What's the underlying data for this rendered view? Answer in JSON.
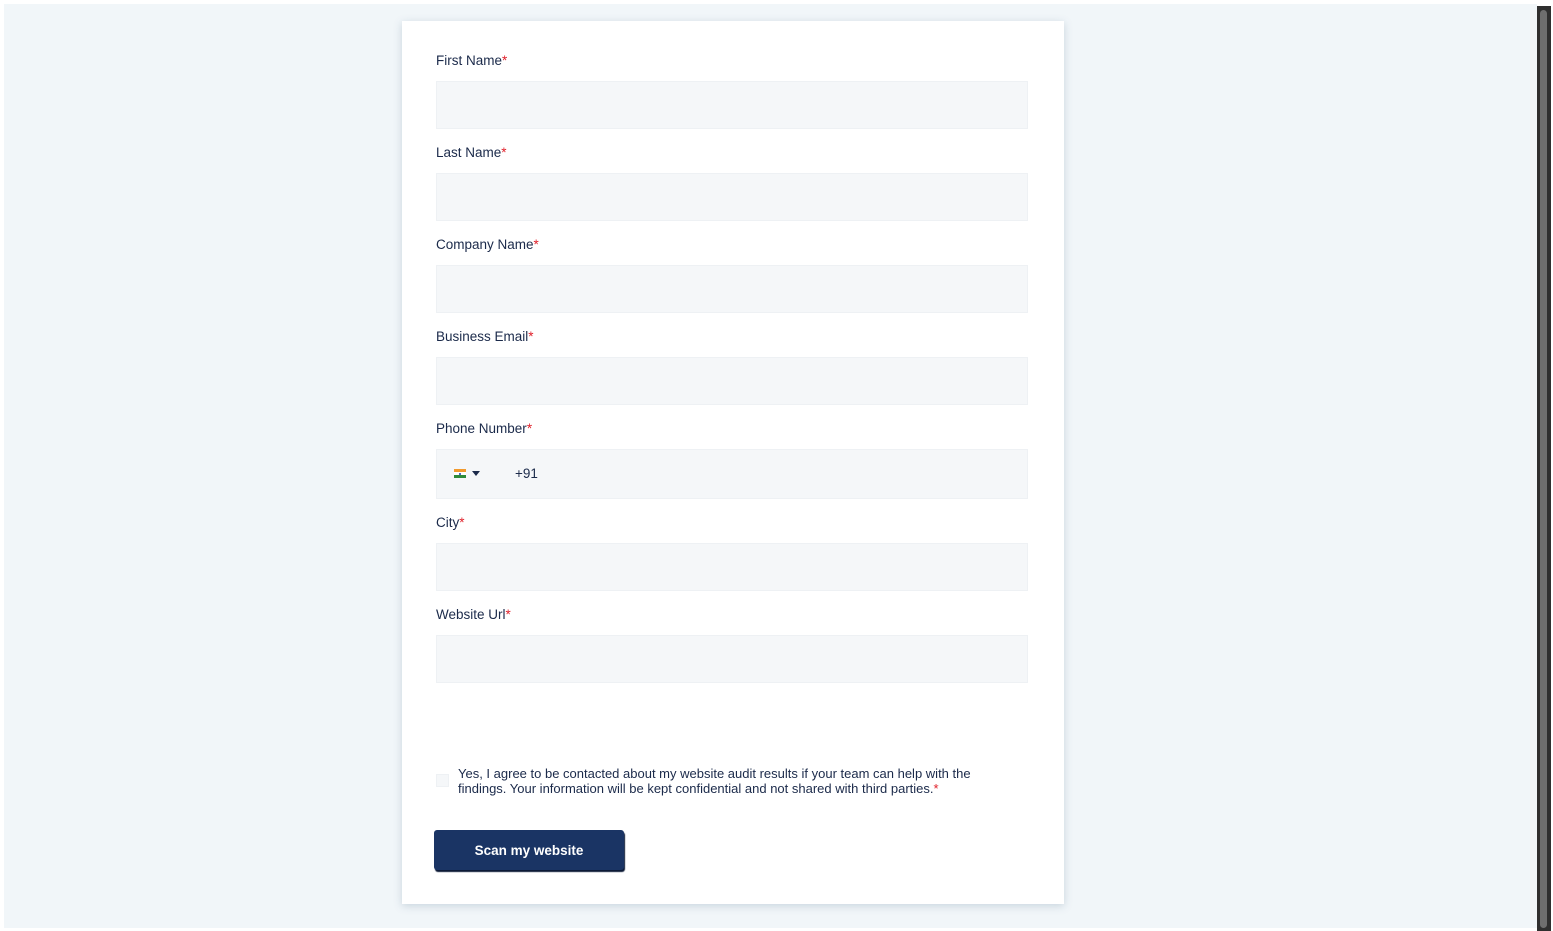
{
  "form": {
    "fields": [
      {
        "label": "First Name",
        "required_mark": "*",
        "value": "",
        "placeholder": ""
      },
      {
        "label": "Last Name",
        "required_mark": "*",
        "value": "",
        "placeholder": ""
      },
      {
        "label": "Company Name",
        "required_mark": "*",
        "value": "",
        "placeholder": ""
      },
      {
        "label": "Business Email",
        "required_mark": "*",
        "value": "",
        "placeholder": ""
      },
      {
        "label": "Phone Number",
        "required_mark": "*",
        "country_flag": "india-flag-icon",
        "dial_code": "+91"
      },
      {
        "label": "City",
        "required_mark": "*",
        "value": "",
        "placeholder": ""
      },
      {
        "label": "Website Url",
        "required_mark": "*",
        "value": "",
        "placeholder": ""
      }
    ],
    "consent": {
      "text": "Yes, I agree to be contacted about my website audit results if your team can help with the findings. Your information will be kept confidential and not shared with third parties.",
      "required_mark": "*",
      "checked": false
    },
    "submit_label": "Scan my website"
  },
  "colors": {
    "page_background": "#f1f6f9",
    "input_background": "#f5f7f9",
    "label_text": "#1b2a4a",
    "required_mark": "#e0202a",
    "button_background": "#1a3464",
    "button_text": "#ffffff"
  }
}
